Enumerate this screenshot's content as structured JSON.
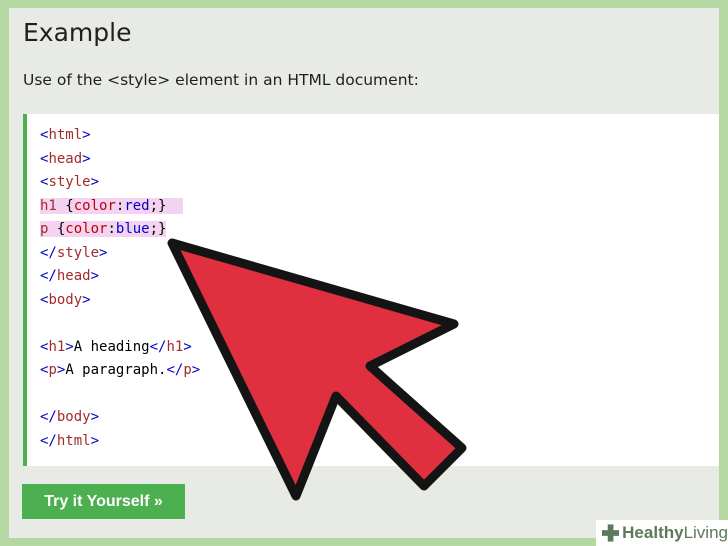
{
  "page": {
    "title": "Example",
    "intro": "Use of the <style> element in an HTML document:",
    "button_label": "Try it Yourself »"
  },
  "code_lines": [
    {
      "parts": [
        {
          "t": "<",
          "c": "brk"
        },
        {
          "t": "html",
          "c": "tag"
        },
        {
          "t": ">",
          "c": "brk"
        }
      ]
    },
    {
      "parts": [
        {
          "t": "<",
          "c": "brk"
        },
        {
          "t": "head",
          "c": "tag"
        },
        {
          "t": ">",
          "c": "brk"
        }
      ]
    },
    {
      "parts": [
        {
          "t": "<",
          "c": "brk"
        },
        {
          "t": "style",
          "c": "tag"
        },
        {
          "t": ">",
          "c": "brk"
        }
      ]
    },
    {
      "highlight": true,
      "parts": [
        {
          "t": "h1 ",
          "c": "tag"
        },
        {
          "t": "{",
          "c": "txt"
        },
        {
          "t": "color",
          "c": "prop"
        },
        {
          "t": ":",
          "c": "txt"
        },
        {
          "t": "red",
          "c": "val"
        },
        {
          "t": ";}  ",
          "c": "txt"
        }
      ]
    },
    {
      "highlight": true,
      "parts": [
        {
          "t": "p ",
          "c": "tag"
        },
        {
          "t": "{",
          "c": "txt"
        },
        {
          "t": "color",
          "c": "prop"
        },
        {
          "t": ":",
          "c": "txt"
        },
        {
          "t": "blue",
          "c": "val"
        },
        {
          "t": ";}",
          "c": "txt"
        }
      ]
    },
    {
      "parts": [
        {
          "t": "</",
          "c": "brk"
        },
        {
          "t": "style",
          "c": "tag"
        },
        {
          "t": ">",
          "c": "brk"
        }
      ]
    },
    {
      "parts": [
        {
          "t": "</",
          "c": "brk"
        },
        {
          "t": "head",
          "c": "tag"
        },
        {
          "t": ">",
          "c": "brk"
        }
      ]
    },
    {
      "parts": [
        {
          "t": "<",
          "c": "brk"
        },
        {
          "t": "body",
          "c": "tag"
        },
        {
          "t": ">",
          "c": "brk"
        }
      ]
    },
    {
      "parts": []
    },
    {
      "parts": [
        {
          "t": "<",
          "c": "brk"
        },
        {
          "t": "h1",
          "c": "tag"
        },
        {
          "t": ">",
          "c": "brk"
        },
        {
          "t": "A heading",
          "c": "txt"
        },
        {
          "t": "</",
          "c": "brk"
        },
        {
          "t": "h1",
          "c": "tag"
        },
        {
          "t": ">",
          "c": "brk"
        }
      ]
    },
    {
      "parts": [
        {
          "t": "<",
          "c": "brk"
        },
        {
          "t": "p",
          "c": "tag"
        },
        {
          "t": ">",
          "c": "brk"
        },
        {
          "t": "A paragraph.",
          "c": "txt"
        },
        {
          "t": "</",
          "c": "brk"
        },
        {
          "t": "p",
          "c": "tag"
        },
        {
          "t": ">",
          "c": "brk"
        }
      ]
    },
    {
      "parts": []
    },
    {
      "parts": [
        {
          "t": "</",
          "c": "brk"
        },
        {
          "t": "body",
          "c": "tag"
        },
        {
          "t": ">",
          "c": "brk"
        }
      ]
    },
    {
      "parts": [
        {
          "t": "</",
          "c": "brk"
        },
        {
          "t": "html",
          "c": "tag"
        },
        {
          "t": ">",
          "c": "brk"
        }
      ]
    }
  ],
  "annotation": {
    "arrow_color": "#e02f3f",
    "arrow_outline": "#141414",
    "icon": "pointer-arrow-icon"
  },
  "watermark": {
    "bold": "Healthy",
    "regular": "Living",
    "icon": "medical-cross-icon",
    "color": "#5c7a5c"
  },
  "colors": {
    "accent": "#4caf50",
    "background": "#b5d7a2",
    "panel": "#e8eae6",
    "highlight": "#f4d3f2"
  }
}
